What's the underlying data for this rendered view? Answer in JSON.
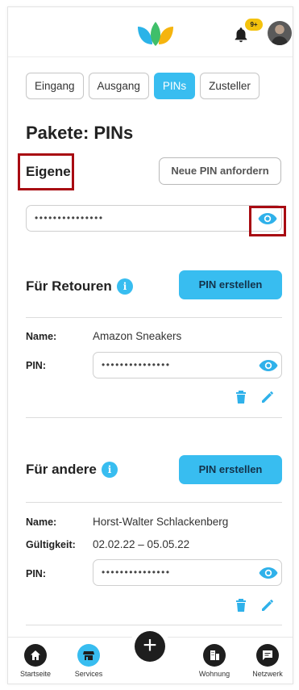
{
  "header": {
    "notification_badge": "9+"
  },
  "tabs": [
    {
      "label": "Eingang",
      "active": false
    },
    {
      "label": "Ausgang",
      "active": false
    },
    {
      "label": "PINs",
      "active": true
    },
    {
      "label": "Zusteller",
      "active": false
    }
  ],
  "page_title": "Pakete: PINs",
  "own": {
    "label": "Eigene",
    "request_button": "Neue PIN anfordern",
    "pin_masked": "•••••••••••••••"
  },
  "returns": {
    "label": "Für Retouren",
    "create_button": "PIN erstellen",
    "entry": {
      "name_label": "Name:",
      "name_value": "Amazon Sneakers",
      "pin_label": "PIN:",
      "pin_masked": "•••••••••••••••"
    }
  },
  "others": {
    "label": "Für andere",
    "create_button": "PIN erstellen",
    "entry": {
      "name_label": "Name:",
      "name_value": "Horst-Walter Schlackenberg",
      "validity_label": "Gültigkeit:",
      "validity_value": "02.02.22 – 05.05.22",
      "pin_label": "PIN:",
      "pin_masked": "•••••••••••••••"
    }
  },
  "bottom_nav": [
    {
      "label": "Startseite",
      "icon": "home-icon",
      "active": false
    },
    {
      "label": "Services",
      "icon": "store-icon",
      "active": true
    },
    {
      "label": "Wohnung",
      "icon": "building-icon",
      "active": false
    },
    {
      "label": "Netzwerk",
      "icon": "chat-icon",
      "active": false
    }
  ],
  "colors": {
    "accent": "#38bdf0",
    "highlight_border": "#a80b12",
    "dark": "#1e1e1e"
  }
}
